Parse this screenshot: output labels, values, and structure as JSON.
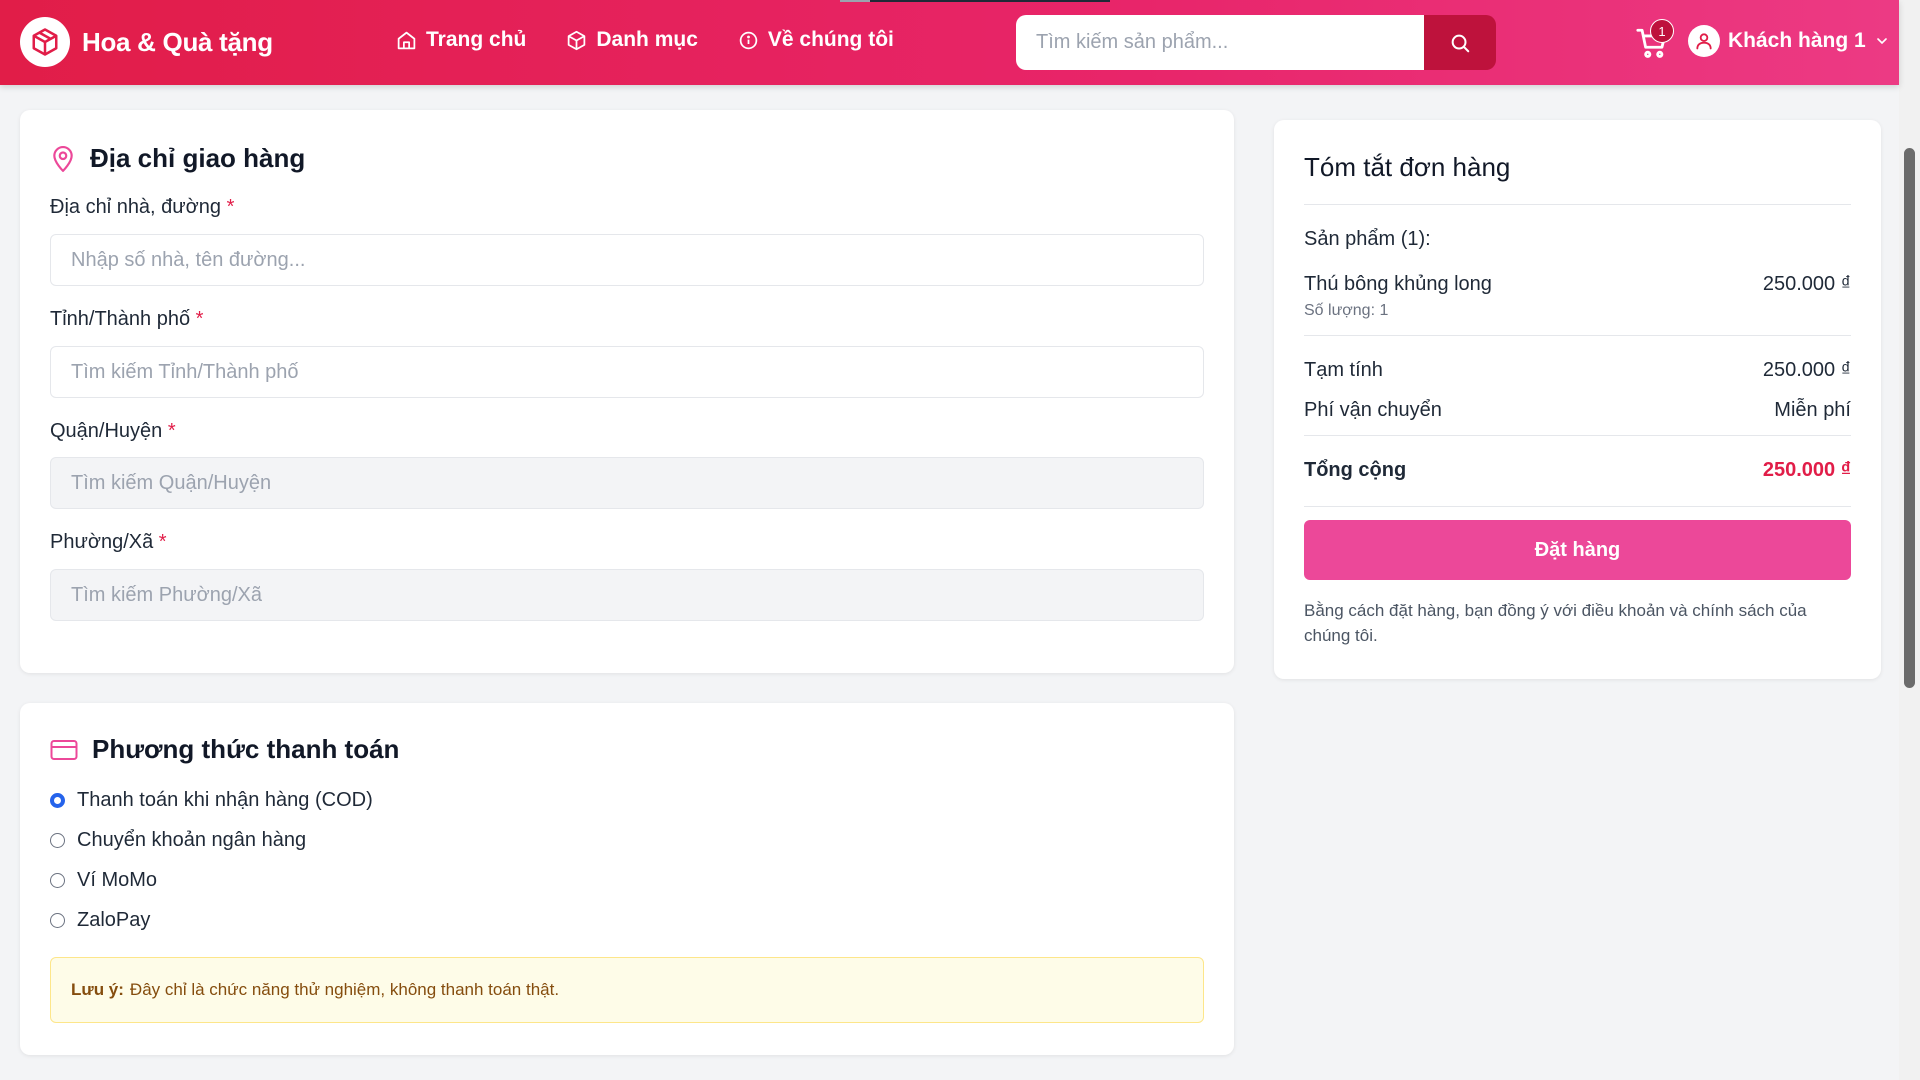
{
  "colors": {
    "primary": "#e11d48",
    "accent_pink": "#ec4899",
    "header_gradient_end": "#ec3a84",
    "link_blue": "#2563eb"
  },
  "header": {
    "brand": "Hoa & Quà tặng",
    "logo_icon": "gift-box-icon",
    "nav": [
      {
        "label": "Trang chủ",
        "icon": "home-icon"
      },
      {
        "label": "Danh mục",
        "icon": "package-icon"
      },
      {
        "label": "Về chúng tôi",
        "icon": "info-icon"
      }
    ],
    "search": {
      "placeholder": "Tìm kiếm sản phẩm...",
      "value": ""
    },
    "cart": {
      "count": "1"
    },
    "user": {
      "name": "Khách hàng 1"
    }
  },
  "address": {
    "title": "Địa chỉ giao hàng",
    "icon": "map-pin-icon",
    "fields": [
      {
        "label": "Địa chỉ nhà, đường",
        "required": "*",
        "placeholder": "Nhập số nhà, tên đường...",
        "disabled": false
      },
      {
        "label": "Tỉnh/Thành phố",
        "required": "*",
        "placeholder": "Tìm kiếm Tỉnh/Thành phố",
        "disabled": false
      },
      {
        "label": "Quận/Huyện",
        "required": "*",
        "placeholder": "Tìm kiếm Quận/Huyện",
        "disabled": true
      },
      {
        "label": "Phường/Xã",
        "required": "*",
        "placeholder": "Tìm kiếm Phường/Xã",
        "disabled": true
      }
    ]
  },
  "payment": {
    "title": "Phương thức thanh toán",
    "icon": "credit-card-icon",
    "options": [
      {
        "label": "Thanh toán khi nhận hàng (COD)",
        "checked": true
      },
      {
        "label": "Chuyển khoản ngân hàng",
        "checked": false
      },
      {
        "label": "Ví MoMo",
        "checked": false
      },
      {
        "label": "ZaloPay",
        "checked": false
      }
    ],
    "note_label": "Lưu ý:",
    "note_text": "Đây chỉ là chức năng thử nghiệm, không thanh toán thật."
  },
  "summary": {
    "title": "Tóm tắt đơn hàng",
    "products_heading": "Sản phẩm (1):",
    "item": {
      "name": "Thú bông khủng long",
      "price": "250.000 ₫",
      "quantity": "Số lượng: 1"
    },
    "subtotal_label": "Tạm tính",
    "subtotal_value": "250.000 ₫",
    "shipping_label": "Phí vận chuyển",
    "shipping_value": "Miễn phí",
    "total_label": "Tổng cộng",
    "total_value": "250.000 ₫",
    "order_button": "Đặt hàng",
    "terms": "Bằng cách đặt hàng, bạn đồng ý với điều khoản và chính sách của chúng tôi."
  }
}
